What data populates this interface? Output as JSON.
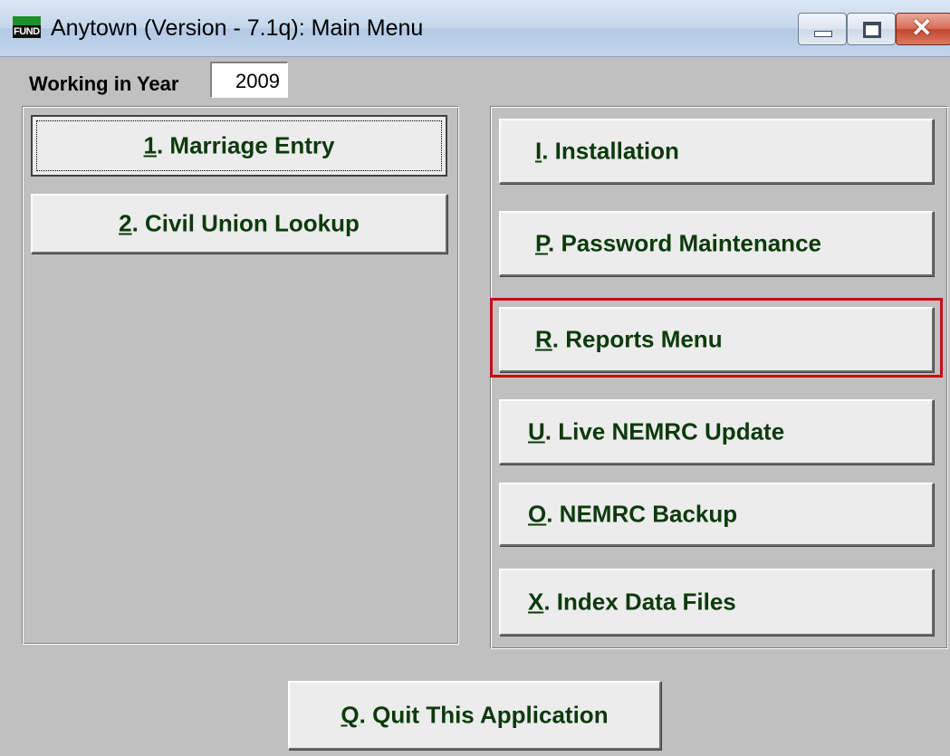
{
  "window": {
    "icon_label": "FUND",
    "title": "Anytown (Version - 7.1q):  Main Menu",
    "minimize_symbol": "—",
    "maximize_symbol": "□",
    "close_symbol": "✕"
  },
  "year": {
    "label": "Working in Year",
    "value": "2009"
  },
  "left_menu": [
    {
      "key": "1",
      "rest": ".  Marriage Entry"
    },
    {
      "key": "2",
      "rest": ". Civil Union Lookup"
    }
  ],
  "right_menu": [
    {
      "key": "I",
      "rest": ".  Installation"
    },
    {
      "key": "P",
      "rest": ".  Password Maintenance"
    },
    {
      "key": "R",
      "rest": ".  Reports Menu"
    },
    {
      "key": "U",
      "rest": ". Live NEMRC Update"
    },
    {
      "key": "O",
      "rest": ". NEMRC Backup"
    },
    {
      "key": "X",
      "rest": ".  Index Data Files"
    }
  ],
  "quit": {
    "key": "Q",
    "rest": ".  Quit This Application"
  },
  "colors": {
    "button_text": "#0c3a0c",
    "highlight_border": "#c01010",
    "window_background": "#c0c0c0"
  }
}
